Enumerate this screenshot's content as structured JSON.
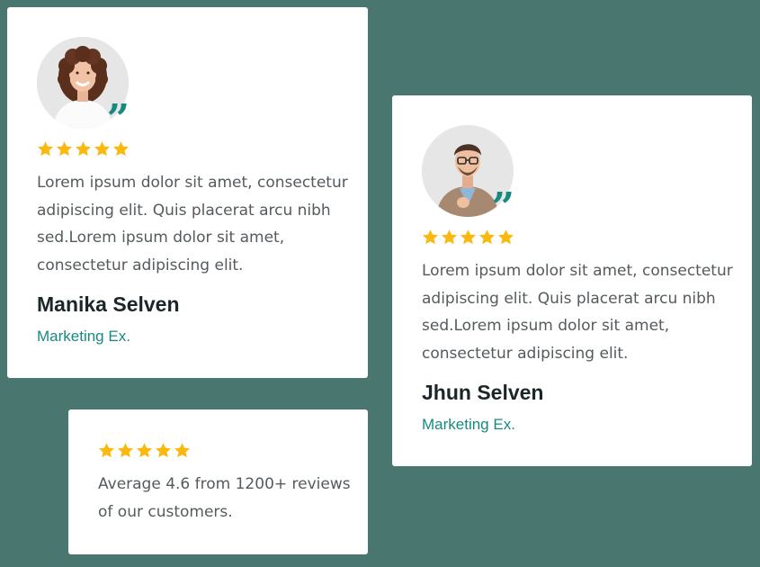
{
  "colors": {
    "background": "#4a7670",
    "card": "#ffffff",
    "star": "#fbb90f",
    "accent": "#178a80",
    "name": "#1b2629",
    "body_text": "#555a5d"
  },
  "testimonials": [
    {
      "rating": 5,
      "text": "Lorem ipsum dolor sit amet, consectetur adipiscing elit. Quis placerat arcu nibh sed.Lorem ipsum dolor sit amet, consectetur adipiscing elit.",
      "name": "Manika Selven",
      "role": "Marketing Ex.",
      "avatar_icon": "avatar-woman-icon",
      "quote_icon": "quote-icon"
    },
    {
      "rating": 5,
      "text": "Lorem ipsum dolor sit amet, consectetur adipiscing elit. Quis placerat arcu nibh sed.Lorem ipsum dolor sit amet, consectetur adipiscing elit.",
      "name": "Jhun Selven",
      "role": "Marketing Ex.",
      "avatar_icon": "avatar-man-icon",
      "quote_icon": "quote-icon"
    }
  ],
  "summary": {
    "rating": 5,
    "text": "Average 4.6 from 1200+ reviews of our customers."
  }
}
